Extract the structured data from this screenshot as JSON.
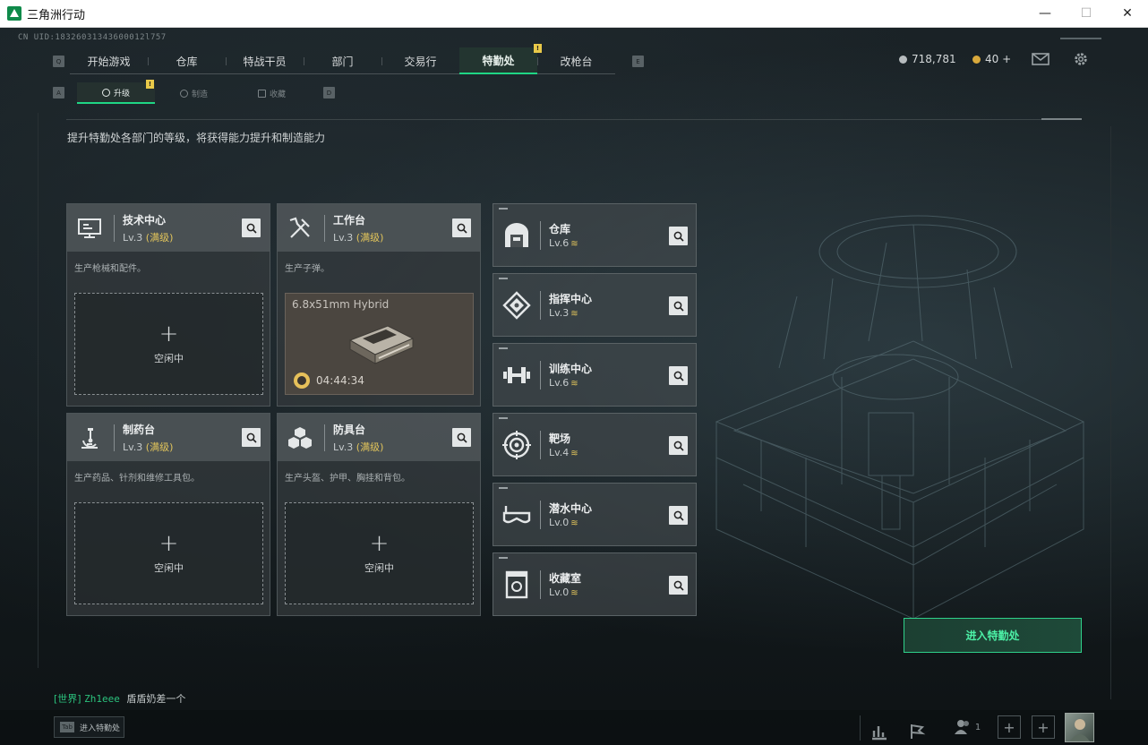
{
  "window": {
    "title": "三角洲行动",
    "min": "—",
    "max": "☐",
    "close": "✕"
  },
  "uid": "CN UID:18326031343600012l757",
  "main_tabs": {
    "left_key": "Q",
    "right_key": "E",
    "items": [
      "开始游戏",
      "仓库",
      "特战干员",
      "部门",
      "交易行",
      "特勤处",
      "改枪台"
    ],
    "active": "特勤处",
    "badge": "!"
  },
  "currency": {
    "coins": "718,781",
    "tickets": "40 +",
    "coin_color": "#b7bcbe",
    "ticket_color": "#d9a93c"
  },
  "sub_tabs": {
    "left_key": "A",
    "right_key": "D",
    "items": [
      "升级",
      "制造",
      "收藏"
    ],
    "active": "升级",
    "badge": "!"
  },
  "description": "提升特勤处各部门的等级，将获得能力提升和制造能力",
  "departments": [
    {
      "title": "技术中心",
      "level": "Lv.3",
      "max": "(满级)",
      "desc": "生产枪械和配件。",
      "icon": "monitor-icon",
      "slot": {
        "state": "idle",
        "plus": "+",
        "label": "空闲中"
      }
    },
    {
      "title": "工作台",
      "level": "Lv.3",
      "max": "(满级)",
      "desc": "生产子弹。",
      "icon": "tools-icon",
      "slot": {
        "state": "busy",
        "item": "6.8x51mm Hybrid",
        "timer": "04:44:34"
      }
    },
    {
      "title": "制药台",
      "level": "Lv.3",
      "max": "(满级)",
      "desc": "生产药品、针剂和维修工具包。",
      "icon": "microscope-icon",
      "slot": {
        "state": "idle",
        "plus": "+",
        "label": "空闲中"
      }
    },
    {
      "title": "防具台",
      "level": "Lv.3",
      "max": "(满级)",
      "desc": "生产头盔、护甲、胸挂和背包。",
      "icon": "armor-icon",
      "slot": {
        "state": "idle",
        "plus": "+",
        "label": "空闲中"
      }
    }
  ],
  "facilities": [
    {
      "title": "仓库",
      "level": "Lv.6",
      "icon": "warehouse-icon",
      "up": "≋"
    },
    {
      "title": "指挥中心",
      "level": "Lv.3",
      "icon": "command-icon",
      "up": "≋"
    },
    {
      "title": "训练中心",
      "level": "Lv.6",
      "icon": "dumbbell-icon",
      "up": "≋"
    },
    {
      "title": "靶场",
      "level": "Lv.4",
      "icon": "target-icon",
      "up": "≋"
    },
    {
      "title": "潜水中心",
      "level": "Lv.0",
      "icon": "goggles-icon",
      "up": "≋"
    },
    {
      "title": "收藏室",
      "level": "Lv.0",
      "icon": "collection-icon",
      "up": "≋"
    }
  ],
  "enter_button": "进入特勤处",
  "chat": {
    "channel": "[世界]",
    "name": "Zh1eee",
    "text": "盾盾奶差一个"
  },
  "bottom": {
    "tab_key": "Tab",
    "tab_text": "进入特勤处",
    "friends": "1",
    "plus": "+"
  },
  "colors": {
    "accent": "#1fd685",
    "gold": "#e1c45b"
  }
}
